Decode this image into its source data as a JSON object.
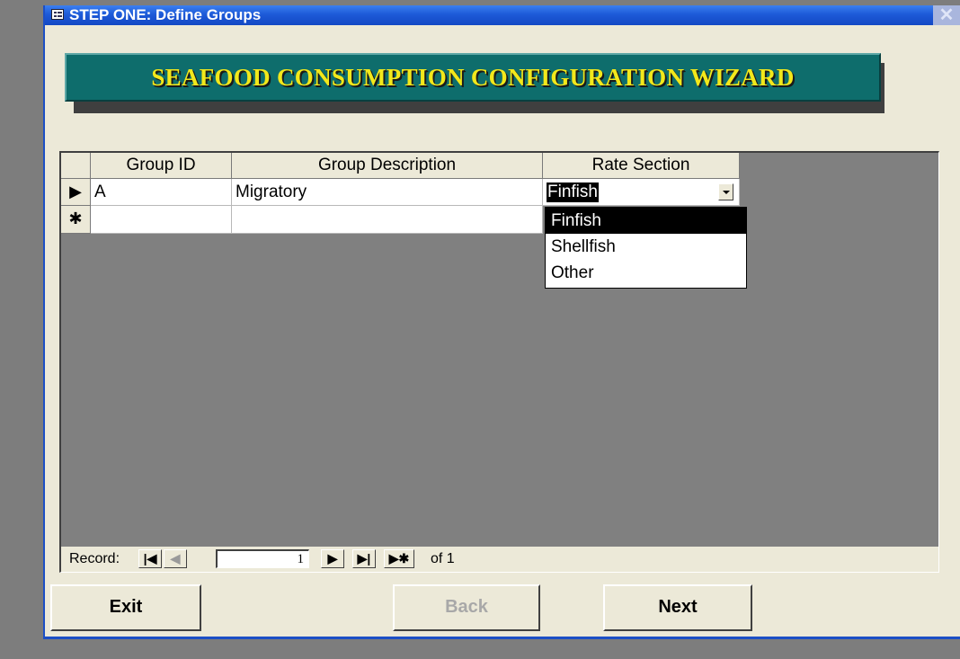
{
  "window": {
    "title": "STEP ONE:  Define Groups",
    "close_label": "✕",
    "app_icon": "form-icon"
  },
  "banner": {
    "text": "SEAFOOD CONSUMPTION CONFIGURATION WIZARD"
  },
  "grid": {
    "columns": [
      "Group ID",
      "Group Description",
      "Rate Section"
    ],
    "rows": [
      {
        "selector": "▶",
        "group_id": "A",
        "description": "Migratory",
        "rate_section": "Finfish"
      },
      {
        "selector": "✱",
        "group_id": "",
        "description": "",
        "rate_section": ""
      }
    ]
  },
  "dropdown": {
    "options": [
      "Finfish",
      "Shellfish",
      "Other"
    ],
    "highlighted": "Finfish"
  },
  "navigation": {
    "label": "Record:",
    "first": "|◀",
    "prev": "◀",
    "current": "1",
    "next": "▶",
    "last": "▶|",
    "new": "▶✱",
    "of_text": "of 1"
  },
  "buttons": {
    "exit": "Exit",
    "back": "Back",
    "next": "Next"
  }
}
